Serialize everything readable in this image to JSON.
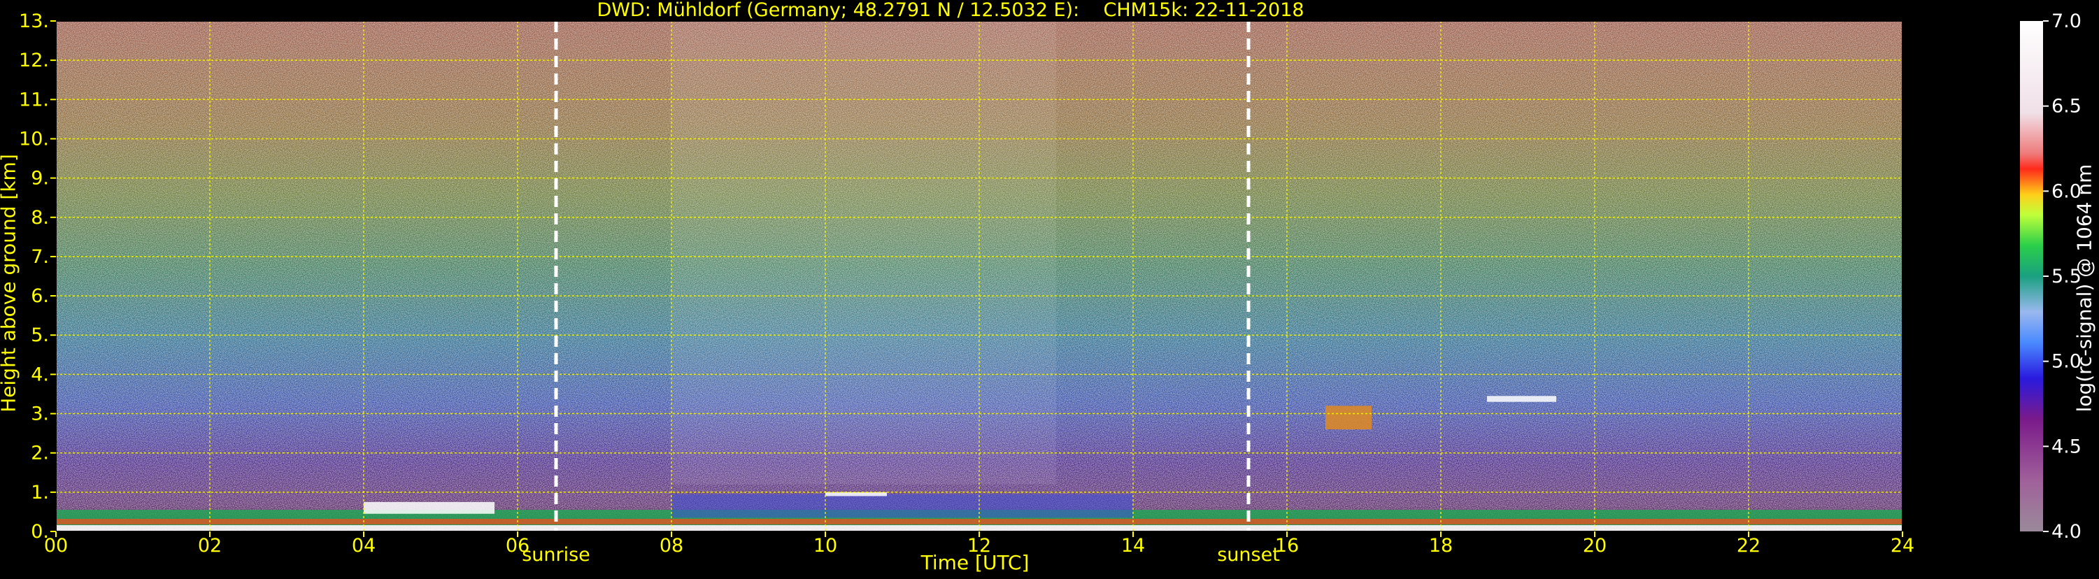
{
  "chart_data": {
    "type": "heatmap",
    "title": "DWD: Mühldorf (Germany; 48.2791 N / 12.5032 E):    CHM15k: 22-11-2018",
    "xlabel": "Time [UTC]",
    "ylabel": "Height above ground [km]",
    "xlim": [
      0,
      24
    ],
    "ylim": [
      0,
      13
    ],
    "x_ticks": [
      "00",
      "02",
      "04",
      "06",
      "08",
      "10",
      "12",
      "14",
      "16",
      "18",
      "20",
      "22",
      "24"
    ],
    "y_ticks": [
      "0.",
      "1.",
      "2.",
      "3.",
      "4.",
      "5.",
      "6.",
      "7.",
      "8.",
      "9.",
      "10.",
      "11.",
      "12.",
      "13."
    ],
    "grid": true,
    "markers": [
      {
        "label": "sunrise",
        "time": 6.5
      },
      {
        "label": "sunset",
        "time": 15.5
      }
    ],
    "colorbar": {
      "label": "log(rc-signal) @ 1064 nm",
      "range": [
        4.0,
        7.0
      ],
      "ticks": [
        "4.0",
        "4.5",
        "5.0",
        "5.5",
        "6.0",
        "6.5",
        "7.0"
      ]
    },
    "colors": {
      "axis_text": "#ffff00",
      "grid": "#ffff00",
      "marker_line": "#ffffff",
      "background": "#000000"
    }
  }
}
